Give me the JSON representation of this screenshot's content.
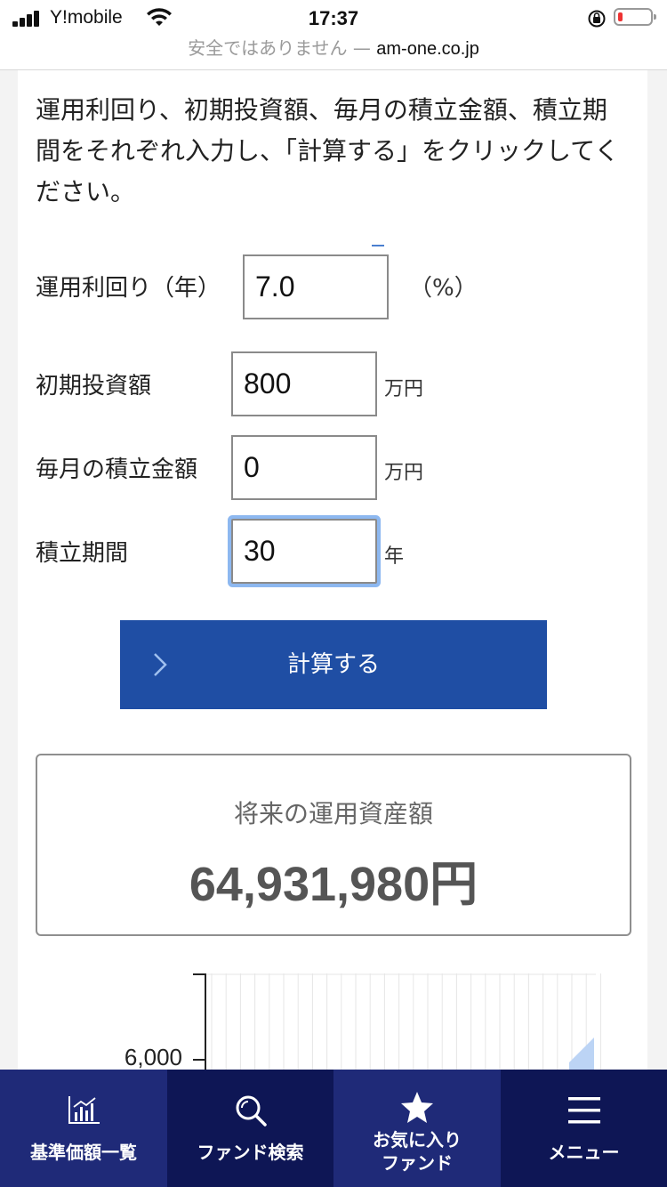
{
  "status_bar": {
    "carrier": "Y!mobile",
    "time": "17:37"
  },
  "url_bar": {
    "warning": "安全ではありません",
    "separator": " — ",
    "host": "am-one.co.jp"
  },
  "intro_text": "運用利回り、初期投資額、毎月の積立金額、積立期間をそれぞれ入力し、「計算する」をクリックしてください。",
  "form": {
    "rate": {
      "label": "運用利回り（年）",
      "value": "7.0",
      "unit": "（%）"
    },
    "initial": {
      "label": "初期投資額",
      "value": "800",
      "unit": "万円"
    },
    "monthly": {
      "label": "毎月の積立金額",
      "value": "0",
      "unit": "万円"
    },
    "period": {
      "label": "積立期間",
      "value": "30",
      "unit": "年"
    }
  },
  "calc_button": {
    "label": "計算する"
  },
  "result": {
    "title": "将来の運用資産額",
    "value": "64,931,980",
    "unit": "円"
  },
  "chart_data": {
    "type": "area",
    "y_tick_labels": [
      "6,000"
    ],
    "grid": true,
    "series_color": "#bcd4f5"
  },
  "bottom_nav": {
    "items": [
      {
        "label": "基準価額一覧",
        "icon": "chart-bars-icon",
        "bg": "#1f2a78"
      },
      {
        "label": "ファンド検索",
        "icon": "search-icon",
        "bg": "#0e1655"
      },
      {
        "label": "お気に入りファンド",
        "label_line1": "お気に入り",
        "label_line2": "ファンド",
        "icon": "star-icon",
        "bg": "#1f2a78"
      },
      {
        "label": "メニュー",
        "icon": "menu-icon",
        "bg": "#0e1655"
      }
    ]
  },
  "colors": {
    "accent_button": "#1f4ea4",
    "focus_ring": "#8db8f0"
  }
}
